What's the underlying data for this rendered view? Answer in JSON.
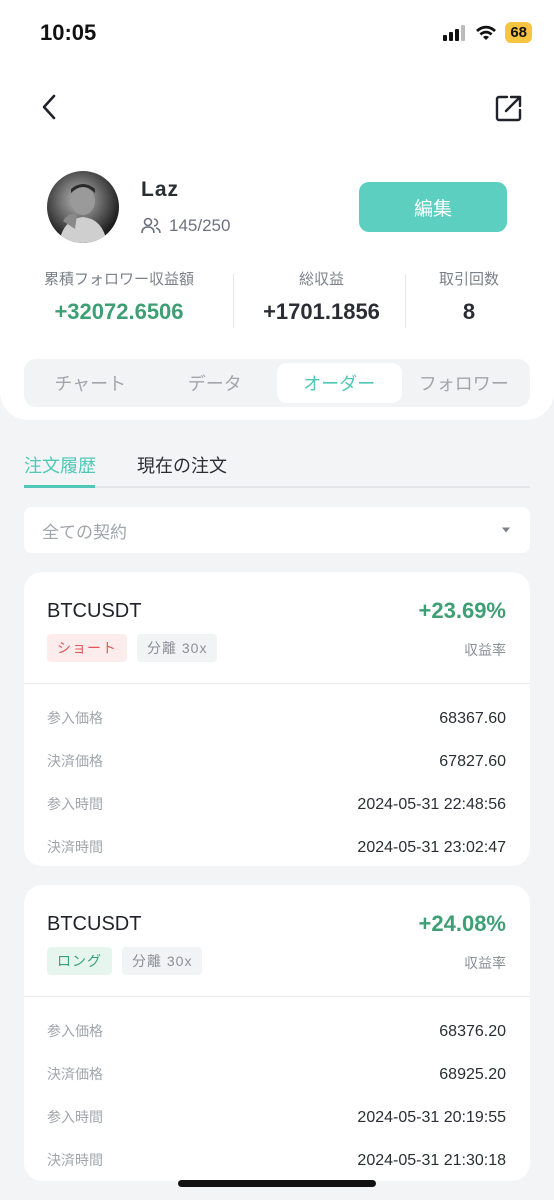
{
  "status_bar": {
    "time": "10:05",
    "battery": "68",
    "icons": [
      "signal-icon",
      "wifi-icon",
      "battery-icon"
    ]
  },
  "nav": {
    "back_icon": "chevron-left-icon",
    "share_icon": "share-icon"
  },
  "profile": {
    "name": "Laz",
    "followers": "145/250",
    "edit_label": "編集"
  },
  "stats": [
    {
      "label": "累積フォロワー収益額",
      "value": "+32072.6506",
      "color": "#3f9f74"
    },
    {
      "label": "総収益",
      "value": "+1701.1856",
      "color": "#2a2e34"
    },
    {
      "label": "取引回数",
      "value": "8",
      "color": "#2a2e34"
    }
  ],
  "tabs": [
    {
      "label": "チャート",
      "active": false
    },
    {
      "label": "データ",
      "active": false
    },
    {
      "label": "オーダー",
      "active": true
    },
    {
      "label": "フォロワー",
      "active": false
    }
  ],
  "subtabs": {
    "history": "注文履歴",
    "current": "現在の注文"
  },
  "filter": {
    "label": "全ての契約"
  },
  "orders": [
    {
      "pair": "BTCUSDT",
      "side": "ショート",
      "margin": "分離 30x",
      "roi": "+23.69%",
      "roi_label": "収益率",
      "rows": [
        {
          "label": "参入価格",
          "value": "68367.60"
        },
        {
          "label": "決済価格",
          "value": "67827.60"
        },
        {
          "label": "参入時間",
          "value": "2024-05-31 22:48:56"
        },
        {
          "label": "決済時間",
          "value": "2024-05-31 23:02:47"
        }
      ]
    },
    {
      "pair": "BTCUSDT",
      "side": "ロング",
      "margin": "分離 30x",
      "roi": "+24.08%",
      "roi_label": "収益率",
      "rows": [
        {
          "label": "参入価格",
          "value": "68376.20"
        },
        {
          "label": "決済価格",
          "value": "68925.20"
        },
        {
          "label": "参入時間",
          "value": "2024-05-31 20:19:55"
        },
        {
          "label": "決済時間",
          "value": "2024-05-31 21:30:18"
        }
      ]
    }
  ]
}
